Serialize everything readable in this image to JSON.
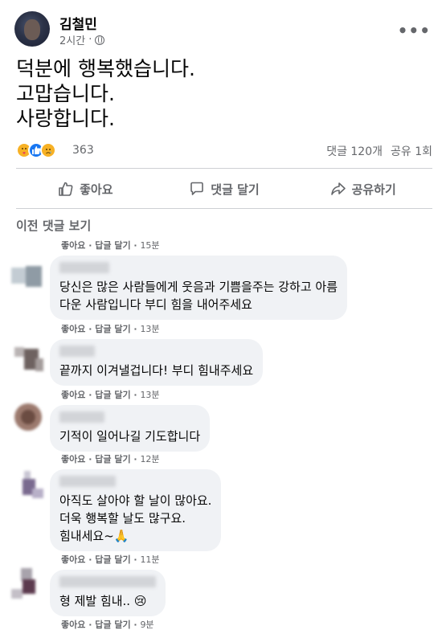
{
  "post": {
    "author": "김철민",
    "time": "2시간",
    "separator": "·",
    "more_icon": "more-horizontal-icon",
    "lines": [
      "덕분에 행복했습니다.",
      "고맙습니다.",
      "사랑합니다."
    ]
  },
  "stats": {
    "reaction_count": "363",
    "comments": "댓글 120개",
    "shares": "공유 1회",
    "reactions": [
      "care",
      "like",
      "sad"
    ]
  },
  "actions": {
    "like": "좋아요",
    "comment": "댓글 달기",
    "share": "공유하기"
  },
  "comments_section": {
    "prev_label": "이전 댓글 보기",
    "like_label": "좋아요",
    "reply_label": "답글 달기",
    "sep": "·"
  },
  "comments": [
    {
      "time": "15분"
    },
    {
      "lines": [
        "당신은 많은 사람들에게 웃음과 기쁨을주는 강하고 아름",
        "다운 사람입니다 부디 힘을 내어주세요"
      ],
      "time": "13분"
    },
    {
      "lines": [
        "끝까지 이겨낼겁니다! 부디 힘내주세요"
      ],
      "time": "13분"
    },
    {
      "lines": [
        "기적이 일어나길 기도합니다"
      ],
      "time": "12분"
    },
    {
      "lines": [
        "아직도 살아야 할 날이 많아요.",
        "더욱 행복할 날도 많구요.",
        "힘내세요~🙏"
      ],
      "time": "11분"
    },
    {
      "lines": [
        "형 제발 힘내.. 😢"
      ],
      "time": "9분"
    }
  ],
  "colors": {
    "text_primary": "#050505",
    "text_secondary": "#65676b",
    "bubble": "#f0f2f5",
    "like_blue": "#1877f2",
    "divider": "#ced0d4"
  }
}
